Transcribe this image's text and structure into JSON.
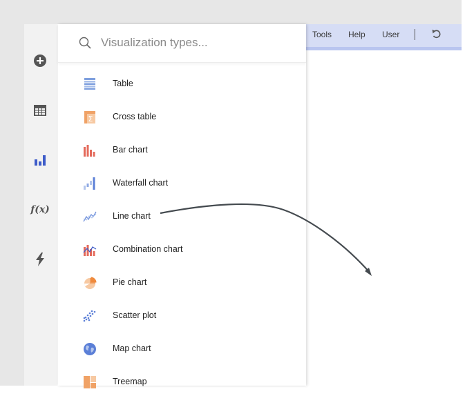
{
  "search": {
    "placeholder": "Visualization types..."
  },
  "menubar": {
    "items": [
      "Tools",
      "Help",
      "User"
    ]
  },
  "visualizations": [
    {
      "label": "Table",
      "icon": "table-icon"
    },
    {
      "label": "Cross table",
      "icon": "cross-table-icon"
    },
    {
      "label": "Bar chart",
      "icon": "bar-chart-icon"
    },
    {
      "label": "Waterfall chart",
      "icon": "waterfall-chart-icon"
    },
    {
      "label": "Line chart",
      "icon": "line-chart-icon"
    },
    {
      "label": "Combination chart",
      "icon": "combination-chart-icon"
    },
    {
      "label": "Pie chart",
      "icon": "pie-chart-icon"
    },
    {
      "label": "Scatter plot",
      "icon": "scatter-plot-icon"
    },
    {
      "label": "Map chart",
      "icon": "map-chart-icon"
    },
    {
      "label": "Treemap",
      "icon": "treemap-icon"
    }
  ],
  "rail": {
    "icons": [
      "add-icon",
      "data-table-icon",
      "visualizations-icon",
      "function-icon",
      "flash-icon"
    ],
    "fx_label": "f(x)"
  },
  "colors": {
    "accent_blue": "#3e5cc9",
    "menubar_bg": "#d6ddf5",
    "orange": "#f2a366",
    "red": "#e25a4a"
  }
}
